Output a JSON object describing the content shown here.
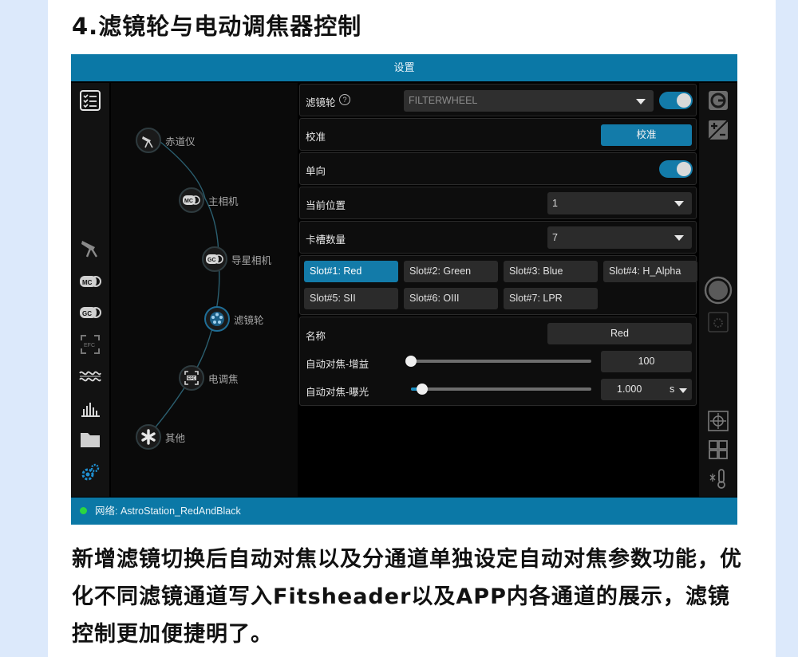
{
  "heading": "4.滤镜轮与电动调焦器控制",
  "app": {
    "title": "设置",
    "left_rail_icons": [
      "checklist-icon",
      "telescope-mount-icon",
      "main-camera-icon",
      "guide-camera-icon",
      "focuser-icon",
      "waveform-icon",
      "histogram-icon",
      "folder-icon",
      "settings-gears-icon"
    ],
    "device_tree": [
      {
        "label": "赤道仪",
        "icon": "telescope-mount-icon",
        "badge": ""
      },
      {
        "label": "主相机",
        "icon": "main-camera-icon",
        "badge": "MC"
      },
      {
        "label": "导星相机",
        "icon": "guide-camera-icon",
        "badge": "GC"
      },
      {
        "label": "滤镜轮",
        "icon": "filter-wheel-icon",
        "badge": ""
      },
      {
        "label": "电调焦",
        "icon": "focuser-icon",
        "badge": "EFC"
      },
      {
        "label": "其他",
        "icon": "asterisk-icon",
        "badge": ""
      }
    ],
    "filter_wheel": {
      "label": "滤镜轮",
      "help": "?",
      "device": "FILTERWHEEL",
      "enabled": true
    },
    "calibrate": {
      "label": "校准",
      "button": "校准"
    },
    "unidirectional": {
      "label": "单向",
      "enabled": true
    },
    "current_position": {
      "label": "当前位置",
      "value": "1"
    },
    "slot_count": {
      "label": "卡槽数量",
      "value": "7"
    },
    "slots": [
      "Slot#1: Red",
      "Slot#2: Green",
      "Slot#3: Blue",
      "Slot#4: H_Alpha",
      "Slot#5: SII",
      "Slot#6: OIII",
      "Slot#7: LPR"
    ],
    "active_slot": 0,
    "name": {
      "label": "名称",
      "value": "Red"
    },
    "af_gain": {
      "label": "自动对焦-增益",
      "value": "100",
      "level": 0.0
    },
    "af_exposure": {
      "label": "自动对焦-曝光",
      "value": "1.000",
      "unit": "s",
      "level": 0.06
    },
    "right_rail_icons": [
      "g-badge-icon",
      "exposure-plus-minus-icon",
      "capture-button-icon",
      "image-settings-icon",
      "target-crosshair-icon",
      "grid-icon",
      "temperature-icon"
    ],
    "status": {
      "text": "网络: AstroStation_RedAndBlack",
      "color": "#2bd641"
    }
  },
  "caption": "新增滤镜切换后自动对焦以及分通道单独设定自动对焦参数功能，优化不同滤镜通道写入Fitsheader以及APP内各通道的展示，滤镜控制更加便捷明了。"
}
